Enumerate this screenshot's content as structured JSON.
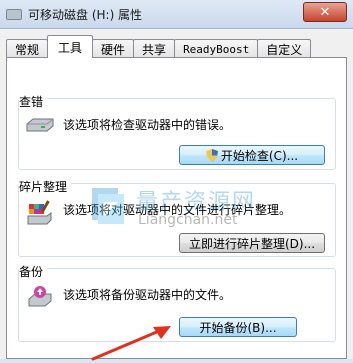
{
  "window": {
    "title": "可移动磁盘 (H:) 属性",
    "close_label": "✕"
  },
  "tabs": [
    {
      "label": "常规"
    },
    {
      "label": "工具"
    },
    {
      "label": "硬件"
    },
    {
      "label": "共享"
    },
    {
      "label": "ReadyBoost"
    },
    {
      "label": "自定义"
    }
  ],
  "active_tab": "工具",
  "groups": {
    "error_check": {
      "title": "查错",
      "description": "该选项将检查驱动器中的错误。",
      "button": "开始检查(C)..."
    },
    "defrag": {
      "title": "碎片整理",
      "description": "该选项将对驱动器中的文件进行碎片整理。",
      "button": "立即进行碎片整理(D)..."
    },
    "backup": {
      "title": "备份",
      "description": "该选项将备份驱动器中的文件。",
      "button": "开始备份(B)..."
    }
  },
  "watermark": {
    "name": "量产资源网",
    "url": "Liangchan.net"
  },
  "colors": {
    "accent": "#3c7fb1",
    "arrow": "#e0301e",
    "close": "#c6452d"
  }
}
